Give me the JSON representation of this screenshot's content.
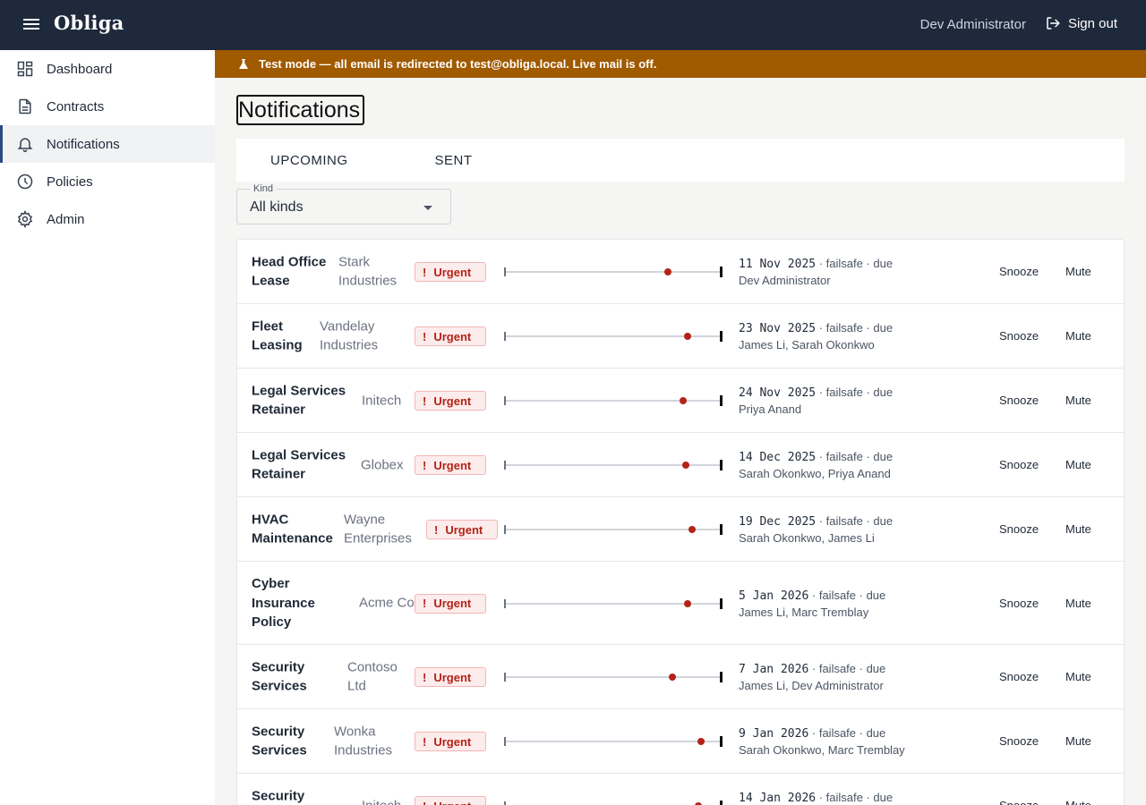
{
  "app": {
    "brand": "Obliga",
    "user": "Dev Administrator",
    "sign_out": "Sign out"
  },
  "sidebar": {
    "items": [
      {
        "label": "Dashboard",
        "icon": "dashboard-icon"
      },
      {
        "label": "Contracts",
        "icon": "document-icon"
      },
      {
        "label": "Notifications",
        "icon": "bell-icon",
        "active": true
      },
      {
        "label": "Policies",
        "icon": "clock-icon"
      },
      {
        "label": "Admin",
        "icon": "gear-icon"
      }
    ]
  },
  "banner": {
    "text": "Test mode — all email is redirected to test@obliga.local. Live mail is off."
  },
  "page": {
    "title": "Notifications",
    "tabs": [
      "UPCOMING",
      "SENT"
    ],
    "filter": {
      "label": "Kind",
      "value": "All kinds"
    }
  },
  "colors": {
    "topbar": "#1e293b",
    "banner": "#a05a00",
    "urgent": "#b42318",
    "active_indicator": "#2c4a7c"
  },
  "notifications": [
    {
      "title": "Head Office Lease",
      "company": "Stark Industries",
      "badge": "Urgent",
      "progress": 0.75,
      "date": "11 Nov 2025",
      "meta": " · failsafe · due",
      "people": "Dev Administrator",
      "snooze": "Snooze",
      "mute": "Mute"
    },
    {
      "title": "Fleet Leasing",
      "company": "Vandelay Industries",
      "badge": "Urgent",
      "progress": 0.84,
      "date": "23 Nov 2025",
      "meta": " · failsafe · due",
      "people": "James Li, Sarah Okonkwo",
      "snooze": "Snooze",
      "mute": "Mute"
    },
    {
      "title": "Legal Services Retainer",
      "company": "Initech",
      "badge": "Urgent",
      "progress": 0.82,
      "date": "24 Nov 2025",
      "meta": " · failsafe · due",
      "people": "Priya Anand",
      "snooze": "Snooze",
      "mute": "Mute"
    },
    {
      "title": "Legal Services Retainer",
      "company": "Globex",
      "badge": "Urgent",
      "progress": 0.83,
      "date": "14 Dec 2025",
      "meta": " · failsafe · due",
      "people": "Sarah Okonkwo, Priya Anand",
      "snooze": "Snooze",
      "mute": "Mute"
    },
    {
      "title": "HVAC Maintenance",
      "company": "Wayne Enterprises",
      "badge": "Urgent",
      "progress": 0.86,
      "date": "19 Dec 2025",
      "meta": " · failsafe · due",
      "people": "Sarah Okonkwo, James Li",
      "snooze": "Snooze",
      "mute": "Mute"
    },
    {
      "title": "Cyber Insurance Policy",
      "company": "Acme Corp",
      "badge": "Urgent",
      "progress": 0.84,
      "date": "5 Jan 2026",
      "meta": " · failsafe · due",
      "people": "James Li, Marc Tremblay",
      "snooze": "Snooze",
      "mute": "Mute"
    },
    {
      "title": "Security Services",
      "company": "Contoso Ltd",
      "badge": "Urgent",
      "progress": 0.77,
      "date": "7 Jan 2026",
      "meta": " · failsafe · due",
      "people": "James Li, Dev Administrator",
      "snooze": "Snooze",
      "mute": "Mute"
    },
    {
      "title": "Security Services",
      "company": "Wonka Industries",
      "badge": "Urgent",
      "progress": 0.9,
      "date": "9 Jan 2026",
      "meta": " · failsafe · due",
      "people": "Sarah Okonkwo, Marc Tremblay",
      "snooze": "Snooze",
      "mute": "Mute"
    },
    {
      "title": "Security Services",
      "company": "Initech",
      "badge": "Urgent",
      "progress": 0.89,
      "date": "14 Jan 2026",
      "meta": " · failsafe · due",
      "people": "",
      "snooze": "Snooze",
      "mute": "Mute"
    }
  ]
}
